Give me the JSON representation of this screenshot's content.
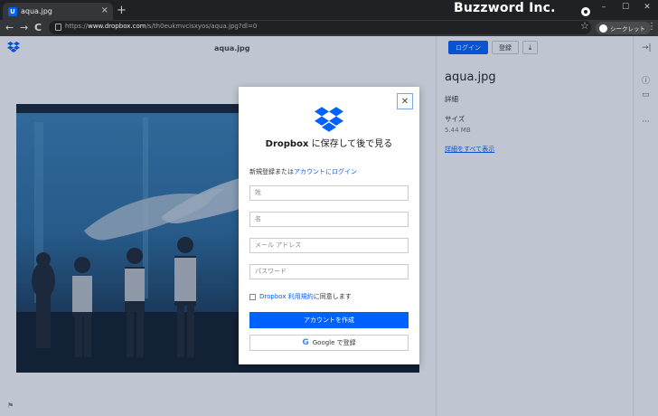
{
  "browser": {
    "tab_title": "aqua.jpg",
    "tab_favicon": "U",
    "new_tab": "+",
    "tab_close": "×",
    "watermark": "Buzzword Inc.",
    "url_prefix": "https://",
    "url_host": "www.dropbox.com",
    "url_path": "/s/th0eukmvcisxyos/aqua.jpg?dl=0",
    "incognito_label": "シークレット",
    "nav_back": "←",
    "nav_forward": "→",
    "nav_reload": "C",
    "star": "☆",
    "menu": "⋮",
    "win_min": "–",
    "win_max": "☐",
    "win_close": "✕"
  },
  "viewer": {
    "filename": "aqua.jpg",
    "login_button": "ログイン",
    "register_button": "登録",
    "download_icon": "⤓",
    "title": "aqua.jpg",
    "details_label": "詳細",
    "size_label": "サイズ",
    "size_value": "5.44 MB",
    "show_all_link": "詳細をすべて表示",
    "rail_collapse": "→|",
    "rail_info": "ⓘ",
    "rail_comment": "▭",
    "rail_more": "···",
    "flag": "⚑"
  },
  "modal": {
    "close": "✕",
    "title_brand": "Dropbox",
    "title_rest": "に保存して後で見る",
    "subtitle_text": "新規登録または",
    "subtitle_link": "アカウントにログイン",
    "last_name_placeholder": "姓",
    "first_name_placeholder": "名",
    "email_placeholder": "メール アドレス",
    "password_placeholder": "パスワード",
    "terms_link": "Dropbox 利用規約",
    "terms_rest": "に同意します",
    "create_button": "アカウントを作成",
    "google_g": "G",
    "google_button": "Google で登録"
  },
  "colors": {
    "accent": "#0061fe",
    "chrome_dark": "#202124"
  }
}
